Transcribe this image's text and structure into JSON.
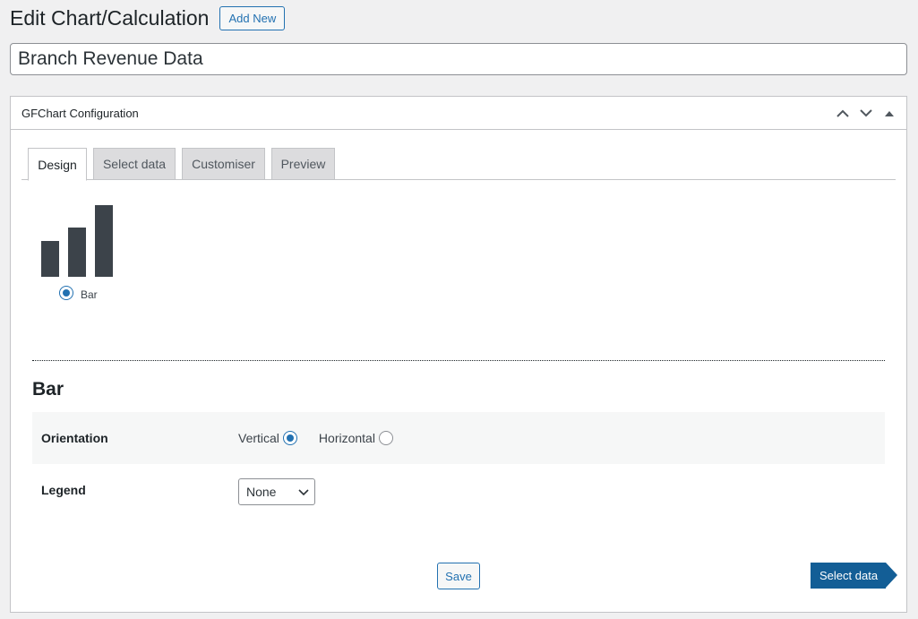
{
  "header": {
    "title": "Edit Chart/Calculation",
    "add_new_label": "Add New"
  },
  "post_title": {
    "value": "Branch Revenue Data"
  },
  "metabox": {
    "title": "GFChart Configuration",
    "actions": [
      "move-up-icon",
      "move-down-icon",
      "collapse-icon"
    ]
  },
  "tabs": [
    {
      "label": "Design",
      "active": true
    },
    {
      "label": "Select data",
      "active": false
    },
    {
      "label": "Customiser",
      "active": false
    },
    {
      "label": "Preview",
      "active": false
    }
  ],
  "chart_types": [
    {
      "label": "Bar",
      "selected": true,
      "icon": "bar-chart-icon"
    }
  ],
  "section": {
    "title": "Bar"
  },
  "settings": {
    "orientation": {
      "label": "Orientation",
      "options": [
        {
          "label": "Vertical",
          "checked": true
        },
        {
          "label": "Horizontal",
          "checked": false
        }
      ]
    },
    "legend": {
      "label": "Legend",
      "value": "None"
    }
  },
  "buttons": {
    "save": "Save",
    "next": "Select data"
  },
  "colors": {
    "accent": "#2271b1",
    "next_button": "#135e96",
    "bar_icon": "#3c434a"
  }
}
